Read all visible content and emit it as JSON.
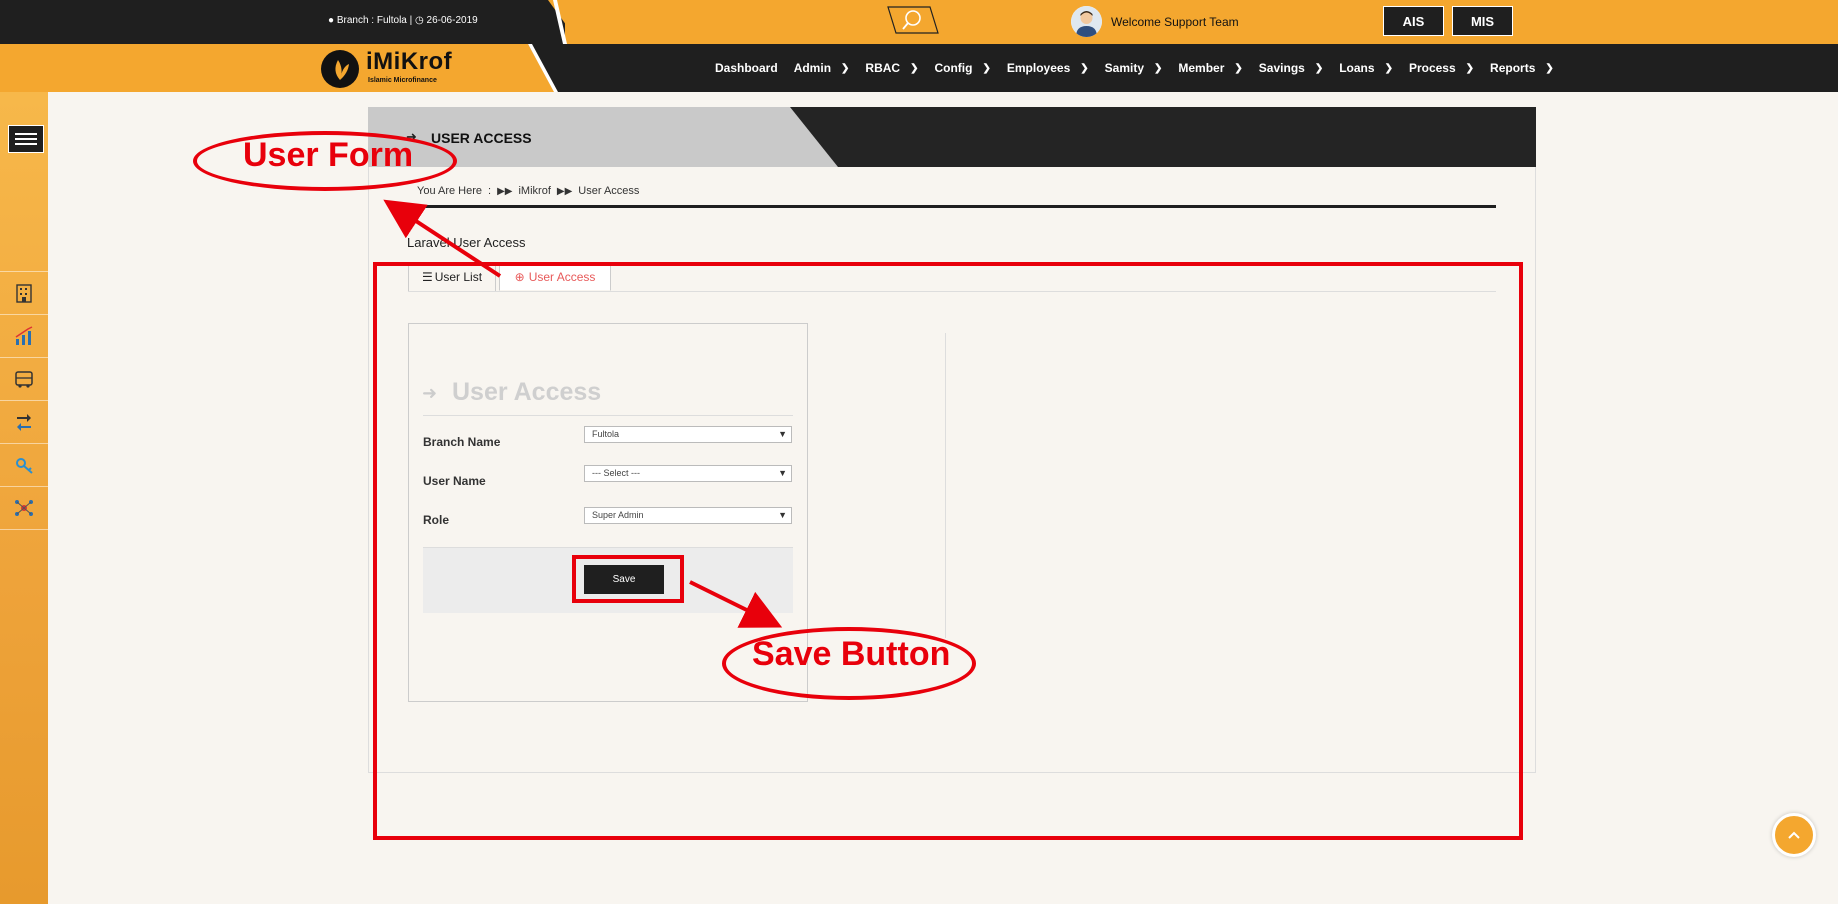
{
  "topbar": {
    "branch_info": "Branch : Fultola |",
    "date": "26-06-2019",
    "welcome": "Welcome Support Team",
    "ais_label": "AIS",
    "mis_label": "MIS"
  },
  "logo": {
    "name": "iMiKrof",
    "subtitle": "Islamic Microfinance"
  },
  "nav": [
    {
      "label": "Dashboard",
      "has_submenu": false
    },
    {
      "label": "Admin",
      "has_submenu": true
    },
    {
      "label": "RBAC",
      "has_submenu": true
    },
    {
      "label": "Config",
      "has_submenu": true
    },
    {
      "label": "Employees",
      "has_submenu": true
    },
    {
      "label": "Samity",
      "has_submenu": true
    },
    {
      "label": "Member",
      "has_submenu": true
    },
    {
      "label": "Savings",
      "has_submenu": true
    },
    {
      "label": "Loans",
      "has_submenu": true
    },
    {
      "label": "Process",
      "has_submenu": true
    },
    {
      "label": "Reports",
      "has_submenu": true
    }
  ],
  "sidebar": {
    "icons": [
      "building-icon",
      "chart-icon",
      "bus-icon",
      "transfer-icon",
      "key-icon",
      "network-icon"
    ]
  },
  "panel": {
    "title": "USER ACCESS",
    "breadcrumb": {
      "prefix": "You Are Here",
      "separator": ":",
      "items": [
        "iMikrof",
        "User Access"
      ]
    },
    "subtitle": "Laravel User Access"
  },
  "tabs": {
    "user_list": "User List",
    "user_access": "User Access"
  },
  "form": {
    "title": "User Access",
    "branch_label": "Branch Name",
    "branch_value": "Fultola",
    "username_label": "User Name",
    "username_value": "--- Select ---",
    "role_label": "Role",
    "role_value": "Super Admin",
    "save_label": "Save"
  },
  "annotations": {
    "user_form": "User Form",
    "save_button": "Save Button",
    "color": "#e8000b"
  },
  "colors": {
    "brand_orange": "#f4a72f",
    "dark": "#1f1f1f"
  }
}
